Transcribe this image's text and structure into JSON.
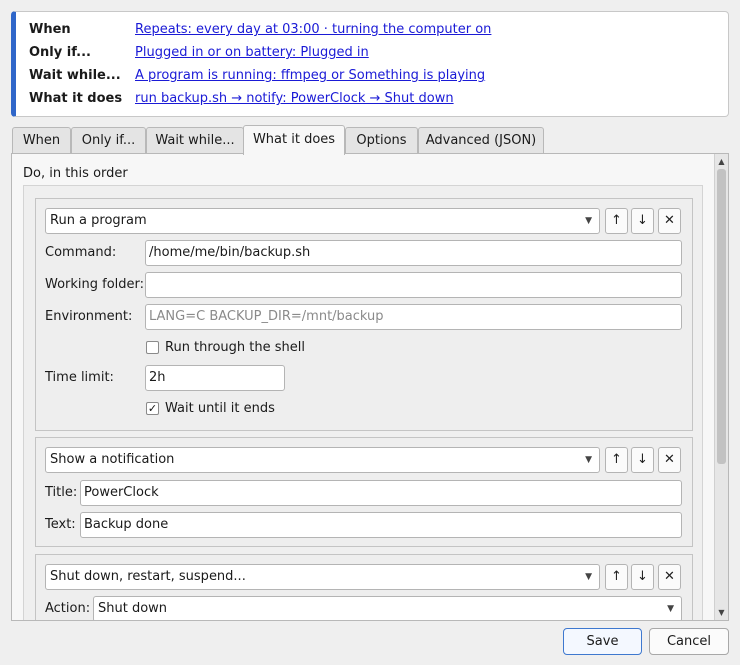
{
  "summary": {
    "when_label": "When",
    "when_value": "Repeats: every day at 03:00 · turning the computer on",
    "onlyif_label": "Only if...",
    "onlyif_value": "Plugged in or on battery: Plugged in",
    "waitwhile_label": "Wait while...",
    "waitwhile_value": "A program is running: ffmpeg or Something is playing",
    "whatitdoes_label": "What it does",
    "whatitdoes_value": "run backup.sh → notify: PowerClock → Shut down"
  },
  "tabs": [
    "When",
    "Only if...",
    "Wait while...",
    "What it does",
    "Options",
    "Advanced (JSON)"
  ],
  "active_tab": "What it does",
  "panel": {
    "section_title": "Do, in this order",
    "step1": {
      "type": "Run a program",
      "command_label": "Command:",
      "command_value": "/home/me/bin/backup.sh",
      "workdir_label": "Working folder:",
      "workdir_value": "",
      "env_label": "Environment:",
      "env_placeholder": "LANG=C BACKUP_DIR=/mnt/backup",
      "shell_label": "Run through the shell",
      "shell_checked": false,
      "timelimit_label": "Time limit:",
      "timelimit_value": "2h",
      "wait_label": "Wait until it ends",
      "wait_checked": true
    },
    "step2": {
      "type": "Show a notification",
      "title_label": "Title:",
      "title_value": "PowerClock",
      "text_label": "Text:",
      "text_value": "Backup done"
    },
    "step3": {
      "type": "Shut down, restart, suspend...",
      "action_label": "Action:",
      "action_value": "Shut down"
    },
    "move_up_glyph": "↑",
    "move_down_glyph": "↓",
    "remove_glyph": "✕",
    "dropdown_glyph": "▼",
    "check_glyph": "✓",
    "scroll_up_glyph": "▲",
    "scroll_down_glyph": "▼"
  },
  "buttons": {
    "save": "Save",
    "cancel": "Cancel"
  },
  "colors": {
    "accent": "#2f66c9",
    "link": "#1a1ad6"
  }
}
